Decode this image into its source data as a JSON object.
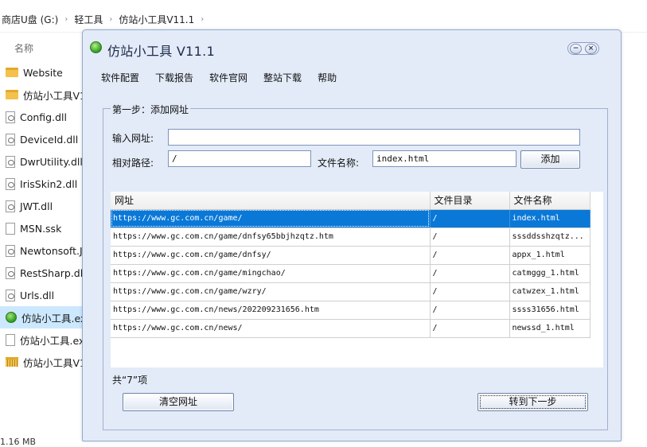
{
  "explorer": {
    "breadcrumb": [
      "商店U盘 (G:)",
      "轻工具",
      "仿站小工具V11.1"
    ],
    "column_header": "名称",
    "files": [
      {
        "name": "Website",
        "icon": "folder-icon"
      },
      {
        "name": "仿站小工具V11",
        "icon": "folder-icon"
      },
      {
        "name": "Config.dll",
        "icon": "dll-file-icon"
      },
      {
        "name": "DeviceId.dll",
        "icon": "dll-file-icon"
      },
      {
        "name": "DwrUtility.dll",
        "icon": "dll-file-icon"
      },
      {
        "name": "IrisSkin2.dll",
        "icon": "dll-file-icon"
      },
      {
        "name": "JWT.dll",
        "icon": "dll-file-icon"
      },
      {
        "name": "MSN.ssk",
        "icon": "document-icon"
      },
      {
        "name": "Newtonsoft.J",
        "icon": "dll-file-icon"
      },
      {
        "name": "RestSharp.dll",
        "icon": "dll-file-icon"
      },
      {
        "name": "Urls.dll",
        "icon": "dll-file-icon"
      },
      {
        "name": "仿站小工具.ex",
        "icon": "exe-app-icon",
        "selected": true
      },
      {
        "name": "仿站小工具.ex",
        "icon": "document-icon"
      },
      {
        "name": "仿站小工具V1",
        "icon": "zip-archive-icon"
      }
    ],
    "status_size": "1.16 MB"
  },
  "app": {
    "title": "仿站小工具 V11.1",
    "window_controls": {
      "minimize": "−",
      "close": "×"
    },
    "menu": [
      "软件配置",
      "下载报告",
      "软件官网",
      "整站下载",
      "帮助"
    ],
    "step_group_label": "第一步：添加网址",
    "url_label": "输入网址:",
    "url_value": "",
    "path_label": "相对路径:",
    "path_value": "/",
    "filename_label": "文件名称:",
    "filename_value": "index.html",
    "add_button": "添加",
    "table": {
      "columns": [
        "网址",
        "文件目录",
        "文件名称"
      ],
      "rows": [
        [
          "https://www.gc.com.cn/game/",
          "/",
          "index.html"
        ],
        [
          "https://www.gc.com.cn/game/dnfsy65bbjhzqtz.htm",
          "/",
          "sssddsshzqtz..."
        ],
        [
          "https://www.gc.com.cn/game/dnfsy/",
          "/",
          "appx_1.html"
        ],
        [
          "https://www.gc.com.cn/game/mingchao/",
          "/",
          "catmggg_1.html"
        ],
        [
          "https://www.gc.com.cn/game/wzry/",
          "/",
          "catwzex_1.html"
        ],
        [
          "https://www.gc.com.cn/news/202209231656.htm",
          "/",
          "ssss31656.html"
        ],
        [
          "https://www.gc.com.cn/news/",
          "/",
          "newssd_1.html"
        ]
      ],
      "selected_row": 0
    },
    "count_text": "共“7”项",
    "clear_button": "清空网址",
    "next_button": "转到下一步",
    "colors": {
      "selection": "#0a78d7",
      "window_bg": "#e3ebf8"
    }
  }
}
